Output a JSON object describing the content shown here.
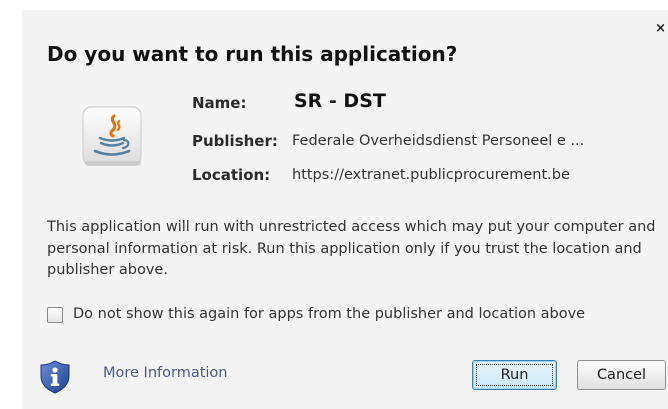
{
  "dialog": {
    "title": "Do you want to run this application?",
    "close_glyph": "×",
    "app_icon": "java-cup-icon",
    "info": {
      "name_label": "Name:",
      "name_value": "SR - DST",
      "publisher_label": "Publisher:",
      "publisher_value": "Federale Overheidsdienst Personeel e ...",
      "location_label": "Location:",
      "location_value": "https://extranet.publicprocurement.be"
    },
    "warning_text": "This application will run with unrestricted access which may put your computer and personal information at risk. Run this application only if you trust the location and publisher above.",
    "checkbox": {
      "label": "Do not show this again for apps from the publisher and location above",
      "checked": false
    },
    "more_info": {
      "icon": "info-shield-icon",
      "label": "More Information"
    },
    "buttons": {
      "run": "Run",
      "cancel": "Cancel"
    }
  }
}
